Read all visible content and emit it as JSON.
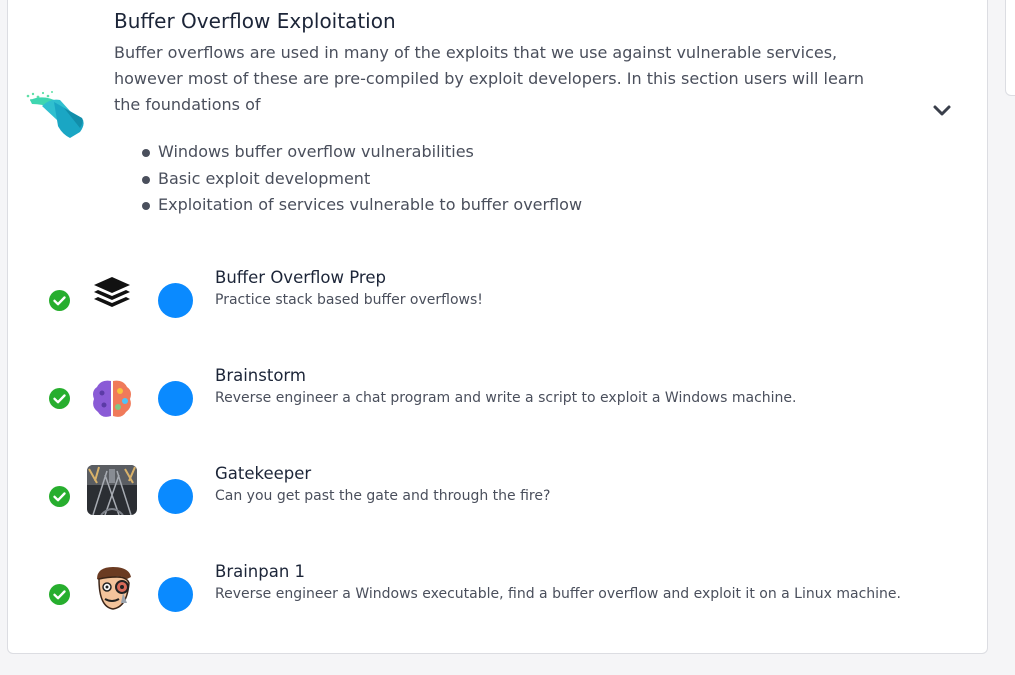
{
  "module": {
    "title": "Buffer Overflow Exploitation",
    "description": "Buffer overflows are used in many of the exploits that we use against vulnerable services, however most of these are pre-compiled by exploit developers. In this section users will learn the foundations of",
    "bullets": [
      "Windows buffer overflow vulnerabilities",
      "Basic exploit development",
      "Exploitation of services vulnerable to buffer overflow"
    ],
    "icon": "paint-bucket-icon"
  },
  "rooms": [
    {
      "title": "Buffer Overflow Prep",
      "description": "Practice stack based buffer overflows!",
      "thumb": "layers-stack-icon",
      "completed": true
    },
    {
      "title": "Brainstorm",
      "description": "Reverse engineer a chat program and write a script to exploit a Windows machine.",
      "thumb": "brain-icon",
      "completed": true
    },
    {
      "title": "Gatekeeper",
      "description": "Can you get past the gate and through the fire?",
      "thumb": "gate-fire-icon",
      "completed": true
    },
    {
      "title": "Brainpan 1",
      "description": "Reverse engineer a Windows executable, find a buffer overflow and exploit it on a Linux machine.",
      "thumb": "cartoon-face-icon",
      "completed": true
    }
  ],
  "colors": {
    "check_green": "#27ae2e",
    "dot_blue": "#0a8aff",
    "title_text": "#1c2538",
    "body_text": "#4a4f5c"
  }
}
